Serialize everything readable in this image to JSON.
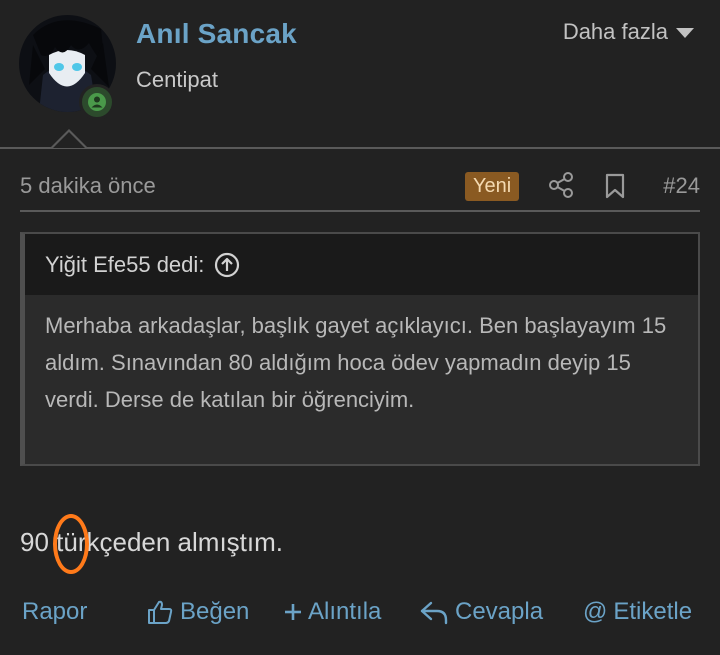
{
  "post": {
    "author": {
      "name": "Anıl Sancak",
      "title": "Centipat",
      "avatar_icon": "anime-avatar-icon",
      "status_icon": "online-user-icon"
    },
    "more_menu": {
      "label": "Daha fazla",
      "icon": "chevron-down-icon"
    },
    "meta": {
      "timestamp": "5 dakika önce",
      "badge": "Yeni",
      "share_icon": "share-icon",
      "bookmark_icon": "bookmark-icon",
      "number": "#24"
    },
    "quote": {
      "header": "Yiğit Efe55 dedi:",
      "header_icon": "arrow-up-circle-icon",
      "text": "Merhaba arkadaşlar, başlık gayet açıklayıcı. Ben başlayayım 15 aldım. Sınavından 80 aldığım hoca ödev yapmadın deyip 15 verdi. Derse de katılan bir öğrenciyim."
    },
    "message": "90 türkçeden almıştım.",
    "actions": {
      "report": "Rapor",
      "like": "Beğen",
      "quote": "Alıntıla",
      "reply": "Cevapla",
      "mention": "Etiketle"
    }
  },
  "colors": {
    "background": "#222222",
    "link": "#6ba3c7",
    "badge_bg": "#8a5a22",
    "annotation": "#ff7a1a"
  }
}
